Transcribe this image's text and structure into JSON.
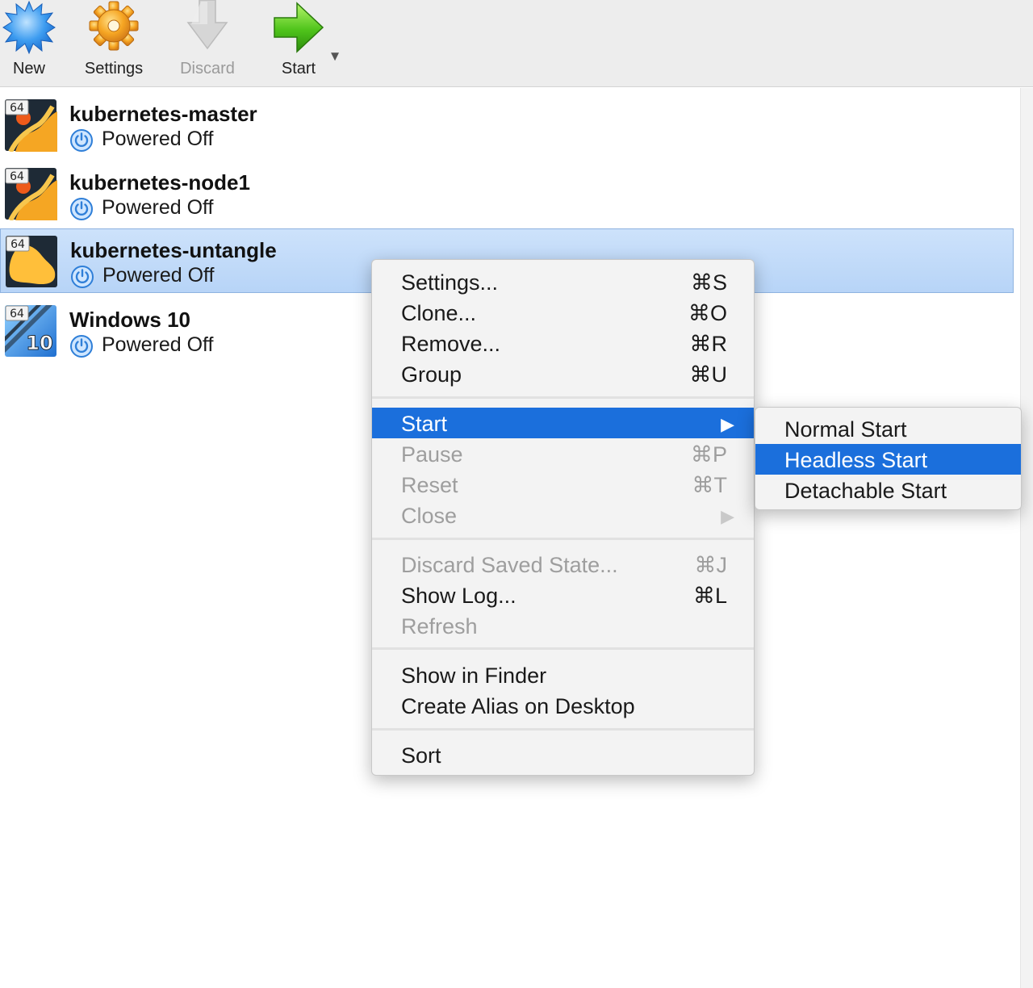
{
  "toolbar": {
    "new": {
      "label": "New",
      "icon": "new-vm-starburst-icon"
    },
    "settings": {
      "label": "Settings",
      "icon": "gear-icon"
    },
    "discard": {
      "label": "Discard",
      "icon": "discard-arrow-down-icon"
    },
    "start": {
      "label": "Start",
      "icon": "start-arrow-right-icon"
    },
    "start_dropdown": "▼"
  },
  "vms": [
    {
      "name": "kubernetes-master",
      "state": "Powered Off",
      "arch_badge": "64",
      "os_icon": "linux-os-icon",
      "selected": false
    },
    {
      "name": "kubernetes-node1",
      "state": "Powered Off",
      "arch_badge": "64",
      "os_icon": "linux-os-icon",
      "selected": false
    },
    {
      "name": "kubernetes-untangle",
      "state": "Powered Off",
      "arch_badge": "64",
      "os_icon": "other-os-icon",
      "selected": true
    },
    {
      "name": "Windows 10",
      "state": "Powered Off",
      "arch_badge": "64",
      "os_badge": "10",
      "os_icon": "windows10-os-icon",
      "selected": false
    }
  ],
  "context_menu": {
    "items": [
      {
        "label": "Settings...",
        "shortcut": "⌘S",
        "enabled": true
      },
      {
        "label": "Clone...",
        "shortcut": "⌘O",
        "enabled": true
      },
      {
        "label": "Remove...",
        "shortcut": "⌘R",
        "enabled": true
      },
      {
        "label": "Group",
        "shortcut": "⌘U",
        "enabled": true
      },
      {
        "label": "Start",
        "shortcut": "",
        "enabled": true,
        "submenu": true,
        "highlighted": true
      },
      {
        "label": "Pause",
        "shortcut": "⌘P",
        "enabled": false
      },
      {
        "label": "Reset",
        "shortcut": "⌘T",
        "enabled": false
      },
      {
        "label": "Close",
        "shortcut": "",
        "enabled": false,
        "submenu": true
      },
      {
        "label": "Discard Saved State...",
        "shortcut": "⌘J",
        "enabled": false
      },
      {
        "label": "Show Log...",
        "shortcut": "⌘L",
        "enabled": true
      },
      {
        "label": "Refresh",
        "shortcut": "",
        "enabled": false
      },
      {
        "label": "Show in Finder",
        "shortcut": "",
        "enabled": true
      },
      {
        "label": "Create Alias on Desktop",
        "shortcut": "",
        "enabled": true
      },
      {
        "label": "Sort",
        "shortcut": "",
        "enabled": true
      }
    ],
    "submenu_arrow": "▶"
  },
  "start_submenu": {
    "items": [
      {
        "label": "Normal Start",
        "highlighted": false
      },
      {
        "label": "Headless Start",
        "highlighted": true
      },
      {
        "label": "Detachable Start",
        "highlighted": false
      }
    ]
  },
  "colors": {
    "highlight": "#1b6fdc",
    "selection_row": "#c3dbf9",
    "linux_icon_orange": "#f5a623",
    "power_icon_blue": "#3a8ee6"
  }
}
